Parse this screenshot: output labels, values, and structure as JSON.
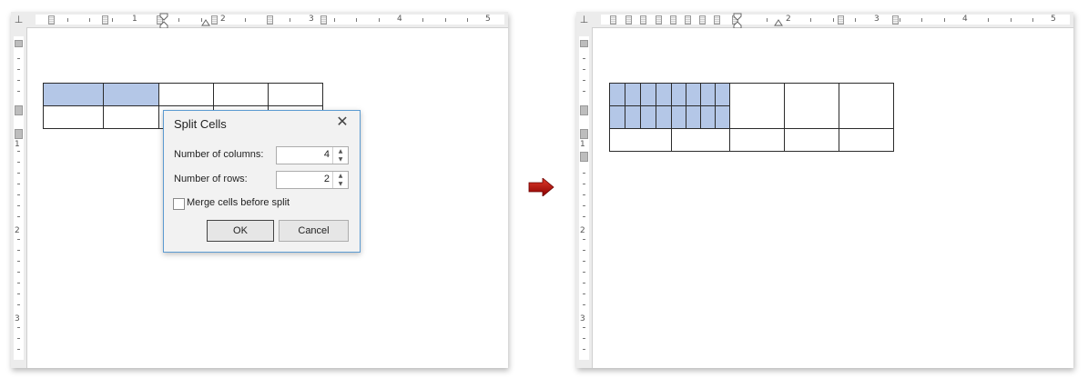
{
  "before": {
    "ruler_numbers": [
      "1",
      "2",
      "3",
      "4",
      "5"
    ],
    "vruler_numbers": [
      "1",
      "2",
      "3"
    ],
    "table": {
      "rows": [
        [
          {
            "selected": true
          },
          {
            "selected": true
          },
          {
            "selected": false
          },
          {
            "selected": false
          },
          {
            "selected": false
          }
        ],
        [
          {
            "selected": false
          },
          {
            "selected": false
          },
          {
            "selected": false
          },
          {
            "selected": false
          },
          {
            "selected": false
          }
        ]
      ]
    }
  },
  "dialog": {
    "title": "Split Cells",
    "columns_label": "Number of columns:",
    "columns_value": "4",
    "rows_label": "Number of rows:",
    "rows_value": "2",
    "merge_label": "Merge cells before split",
    "merge_checked": false,
    "ok_label": "OK",
    "cancel_label": "Cancel"
  },
  "after": {
    "ruler_numbers": [
      "2",
      "3",
      "4",
      "5"
    ],
    "vruler_numbers": [
      "1",
      "2",
      "3"
    ],
    "split_grid": {
      "columns": 8,
      "rows": 2,
      "selected": true
    }
  },
  "colors": {
    "selection": "#b4c7e7",
    "arrow": "#c00000",
    "dialog_border": "#5c9bd1"
  },
  "icons": {
    "transition": "right-arrow-icon",
    "dialog_close": "close-icon",
    "ruler_corner": "tab-stop-icon"
  }
}
